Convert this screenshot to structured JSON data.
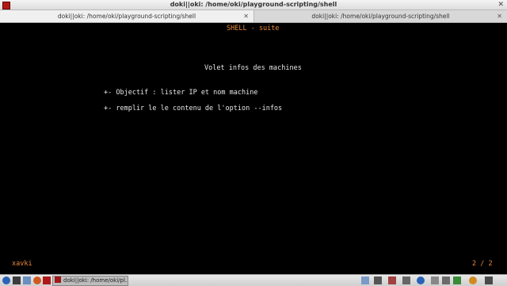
{
  "window": {
    "title": "doki||oki: /home/oki/playground-scripting/shell",
    "close_glyph": "✕"
  },
  "tabs": [
    {
      "label": "doki||oki: /home/oki/playground-scripting/shell",
      "close_glyph": "✕"
    },
    {
      "label": "doki||oki: /home/oki/playground-scripting/shell",
      "close_glyph": "✕"
    }
  ],
  "terminal": {
    "header": "SHELL - suite",
    "heading": "Volet infos des machines",
    "line1": "+- Objectif : lister IP et nom machine",
    "line2": "+- remplir le le contenu de l'option --infos",
    "footer_left": "xavki",
    "footer_right": "2 / 2",
    "colors": {
      "accent": "#e8883a",
      "text": "#e8e8e8",
      "background": "#000000"
    }
  },
  "taskbar": {
    "task_label": "doki||oki: /home/oki/pl...",
    "icons": [
      "menu-icon",
      "terminal-icon",
      "files-icon",
      "browser-icon",
      "app-icon",
      "tray-icons",
      "clock-icon"
    ]
  }
}
